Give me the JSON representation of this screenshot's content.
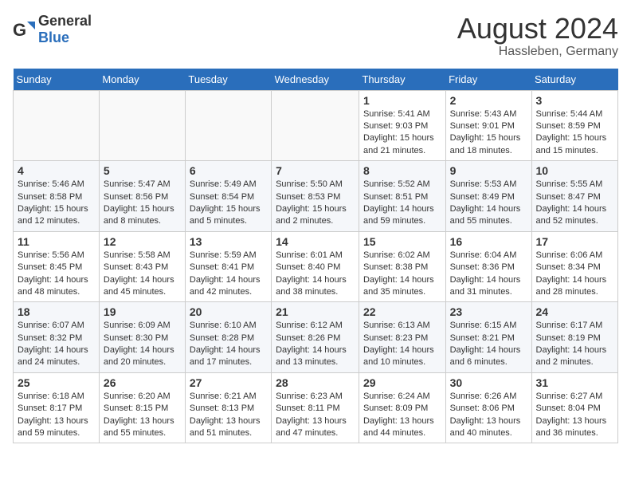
{
  "header": {
    "logo_general": "General",
    "logo_blue": "Blue",
    "main_title": "August 2024",
    "sub_title": "Hassleben, Germany"
  },
  "weekdays": [
    "Sunday",
    "Monday",
    "Tuesday",
    "Wednesday",
    "Thursday",
    "Friday",
    "Saturday"
  ],
  "weeks": [
    [
      {
        "day": "",
        "info": ""
      },
      {
        "day": "",
        "info": ""
      },
      {
        "day": "",
        "info": ""
      },
      {
        "day": "",
        "info": ""
      },
      {
        "day": "1",
        "info": "Sunrise: 5:41 AM\nSunset: 9:03 PM\nDaylight: 15 hours and 21 minutes."
      },
      {
        "day": "2",
        "info": "Sunrise: 5:43 AM\nSunset: 9:01 PM\nDaylight: 15 hours and 18 minutes."
      },
      {
        "day": "3",
        "info": "Sunrise: 5:44 AM\nSunset: 8:59 PM\nDaylight: 15 hours and 15 minutes."
      }
    ],
    [
      {
        "day": "4",
        "info": "Sunrise: 5:46 AM\nSunset: 8:58 PM\nDaylight: 15 hours and 12 minutes."
      },
      {
        "day": "5",
        "info": "Sunrise: 5:47 AM\nSunset: 8:56 PM\nDaylight: 15 hours and 8 minutes."
      },
      {
        "day": "6",
        "info": "Sunrise: 5:49 AM\nSunset: 8:54 PM\nDaylight: 15 hours and 5 minutes."
      },
      {
        "day": "7",
        "info": "Sunrise: 5:50 AM\nSunset: 8:53 PM\nDaylight: 15 hours and 2 minutes."
      },
      {
        "day": "8",
        "info": "Sunrise: 5:52 AM\nSunset: 8:51 PM\nDaylight: 14 hours and 59 minutes."
      },
      {
        "day": "9",
        "info": "Sunrise: 5:53 AM\nSunset: 8:49 PM\nDaylight: 14 hours and 55 minutes."
      },
      {
        "day": "10",
        "info": "Sunrise: 5:55 AM\nSunset: 8:47 PM\nDaylight: 14 hours and 52 minutes."
      }
    ],
    [
      {
        "day": "11",
        "info": "Sunrise: 5:56 AM\nSunset: 8:45 PM\nDaylight: 14 hours and 48 minutes."
      },
      {
        "day": "12",
        "info": "Sunrise: 5:58 AM\nSunset: 8:43 PM\nDaylight: 14 hours and 45 minutes."
      },
      {
        "day": "13",
        "info": "Sunrise: 5:59 AM\nSunset: 8:41 PM\nDaylight: 14 hours and 42 minutes."
      },
      {
        "day": "14",
        "info": "Sunrise: 6:01 AM\nSunset: 8:40 PM\nDaylight: 14 hours and 38 minutes."
      },
      {
        "day": "15",
        "info": "Sunrise: 6:02 AM\nSunset: 8:38 PM\nDaylight: 14 hours and 35 minutes."
      },
      {
        "day": "16",
        "info": "Sunrise: 6:04 AM\nSunset: 8:36 PM\nDaylight: 14 hours and 31 minutes."
      },
      {
        "day": "17",
        "info": "Sunrise: 6:06 AM\nSunset: 8:34 PM\nDaylight: 14 hours and 28 minutes."
      }
    ],
    [
      {
        "day": "18",
        "info": "Sunrise: 6:07 AM\nSunset: 8:32 PM\nDaylight: 14 hours and 24 minutes."
      },
      {
        "day": "19",
        "info": "Sunrise: 6:09 AM\nSunset: 8:30 PM\nDaylight: 14 hours and 20 minutes."
      },
      {
        "day": "20",
        "info": "Sunrise: 6:10 AM\nSunset: 8:28 PM\nDaylight: 14 hours and 17 minutes."
      },
      {
        "day": "21",
        "info": "Sunrise: 6:12 AM\nSunset: 8:26 PM\nDaylight: 14 hours and 13 minutes."
      },
      {
        "day": "22",
        "info": "Sunrise: 6:13 AM\nSunset: 8:23 PM\nDaylight: 14 hours and 10 minutes."
      },
      {
        "day": "23",
        "info": "Sunrise: 6:15 AM\nSunset: 8:21 PM\nDaylight: 14 hours and 6 minutes."
      },
      {
        "day": "24",
        "info": "Sunrise: 6:17 AM\nSunset: 8:19 PM\nDaylight: 14 hours and 2 minutes."
      }
    ],
    [
      {
        "day": "25",
        "info": "Sunrise: 6:18 AM\nSunset: 8:17 PM\nDaylight: 13 hours and 59 minutes."
      },
      {
        "day": "26",
        "info": "Sunrise: 6:20 AM\nSunset: 8:15 PM\nDaylight: 13 hours and 55 minutes."
      },
      {
        "day": "27",
        "info": "Sunrise: 6:21 AM\nSunset: 8:13 PM\nDaylight: 13 hours and 51 minutes."
      },
      {
        "day": "28",
        "info": "Sunrise: 6:23 AM\nSunset: 8:11 PM\nDaylight: 13 hours and 47 minutes."
      },
      {
        "day": "29",
        "info": "Sunrise: 6:24 AM\nSunset: 8:09 PM\nDaylight: 13 hours and 44 minutes."
      },
      {
        "day": "30",
        "info": "Sunrise: 6:26 AM\nSunset: 8:06 PM\nDaylight: 13 hours and 40 minutes."
      },
      {
        "day": "31",
        "info": "Sunrise: 6:27 AM\nSunset: 8:04 PM\nDaylight: 13 hours and 36 minutes."
      }
    ]
  ]
}
